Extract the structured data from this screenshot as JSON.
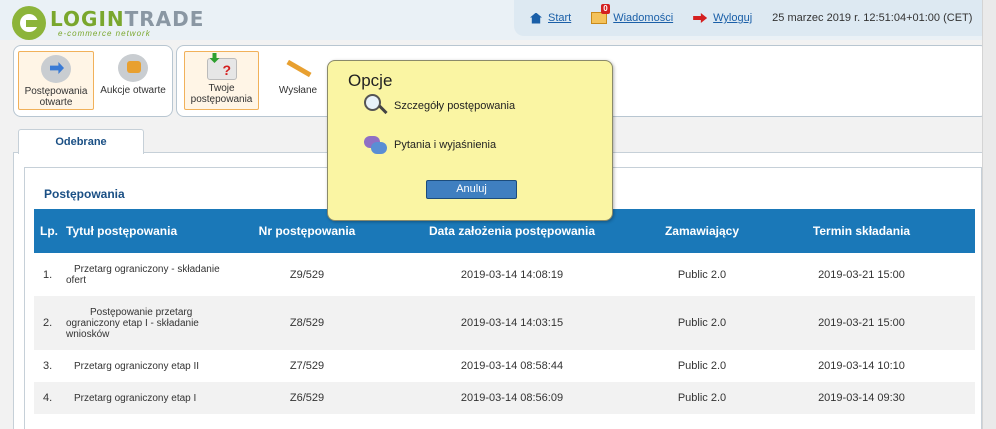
{
  "logo": {
    "name_part1": "LOGIN",
    "name_part2": "TRADE",
    "tagline": "e-commerce network"
  },
  "toplinks": {
    "start": "Start",
    "messages": "Wiadomości",
    "messages_badge": "0",
    "logout": "Wyloguj",
    "datetime": "25 marzec 2019 r. 12:51:04+01:00 (CET)"
  },
  "toolbar": {
    "group1": [
      {
        "label_line1": "Postępowania",
        "label_line2": "otwarte",
        "icon": "arrow-globe-icon",
        "active": true
      },
      {
        "label_line1": "Aukcje otwarte",
        "label_line2": "",
        "icon": "hammer-globe-icon",
        "active": false
      }
    ],
    "group2": [
      {
        "label_line1": "Twoje",
        "label_line2": "postępowania",
        "icon": "envelope-question-icon",
        "active": true
      },
      {
        "label_line1": "Wysłane",
        "label_line2": "",
        "icon": "pencil-icon",
        "active": false
      }
    ]
  },
  "tab": {
    "label": "Odebrane"
  },
  "section": {
    "title": "Postępowania"
  },
  "table": {
    "headers": [
      "Lp.",
      "Tytuł postępowania",
      "Nr postępowania",
      "Data założenia postępowania",
      "Zamawiający",
      "Termin składania"
    ],
    "rows": [
      {
        "lp": "1.",
        "title_lines": [
          "Przetarg ograniczony - składanie",
          "ofert"
        ],
        "nr": "Z9/529",
        "date": "2019-03-14 14:08:19",
        "buyer": "Public 2.0",
        "deadline": "2019-03-21 15:00"
      },
      {
        "lp": "2.",
        "title_lines": [
          "Postępowanie przetarg",
          "ograniczony etap I - składanie",
          "wniosków"
        ],
        "nr": "Z8/529",
        "date": "2019-03-14 14:03:15",
        "buyer": "Public 2.0",
        "deadline": "2019-03-21 15:00"
      },
      {
        "lp": "3.",
        "title_lines": [
          "Przetarg ograniczony etap II"
        ],
        "nr": "Z7/529",
        "date": "2019-03-14 08:58:44",
        "buyer": "Public 2.0",
        "deadline": "2019-03-14 10:10"
      },
      {
        "lp": "4.",
        "title_lines": [
          "Przetarg ograniczony etap I"
        ],
        "nr": "Z6/529",
        "date": "2019-03-14 08:56:09",
        "buyer": "Public 2.0",
        "deadline": "2019-03-14 09:30"
      }
    ]
  },
  "modal": {
    "title": "Opcje",
    "option1": "Szczegóły postępowania",
    "option2": "Pytania i wyjaśnienia",
    "cancel": "Anuluj"
  }
}
